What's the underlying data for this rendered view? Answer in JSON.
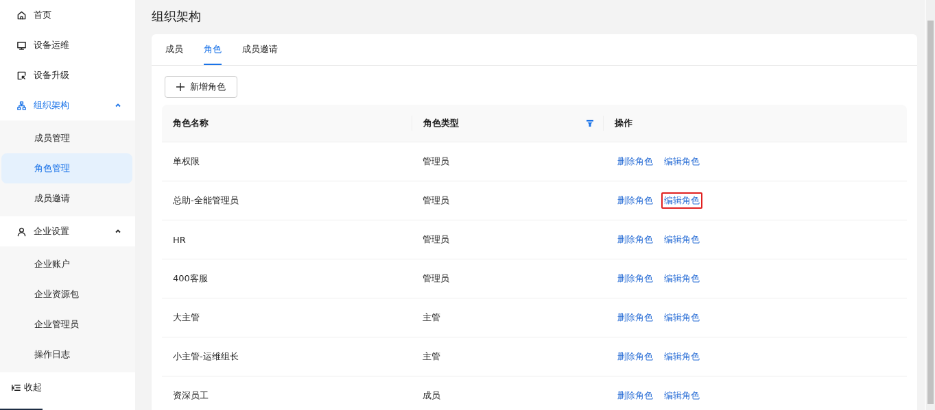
{
  "sidebar": {
    "items": [
      {
        "label": "首页"
      },
      {
        "label": "设备运维"
      },
      {
        "label": "设备升级"
      },
      {
        "label": "组织架构",
        "expanded": true,
        "active": true,
        "children": [
          {
            "label": "成员管理",
            "selected": false
          },
          {
            "label": "角色管理",
            "selected": true
          },
          {
            "label": "成员邀请",
            "selected": false
          }
        ]
      },
      {
        "label": "企业设置",
        "expanded": true,
        "active": false,
        "children": [
          {
            "label": "企业账户",
            "selected": false
          },
          {
            "label": "企业资源包",
            "selected": false
          },
          {
            "label": "企业管理员",
            "selected": false
          },
          {
            "label": "操作日志",
            "selected": false
          }
        ]
      }
    ],
    "collapse": "收起"
  },
  "page": {
    "title": "组织架构"
  },
  "tabs": [
    {
      "label": "成员",
      "selected": false
    },
    {
      "label": "角色",
      "selected": true
    },
    {
      "label": "成员邀请",
      "selected": false
    }
  ],
  "add_button": "新增角色",
  "table": {
    "columns": [
      {
        "label": "角色名称",
        "filter": false
      },
      {
        "label": "角色类型",
        "filter": true
      },
      {
        "label": "操作",
        "filter": false
      }
    ],
    "rows": [
      {
        "name": "单权限",
        "type": "管理员",
        "actions": [
          {
            "label": "删除角色",
            "highlighted": false
          },
          {
            "label": "编辑角色",
            "highlighted": false
          }
        ]
      },
      {
        "name": "总助-全能管理员",
        "type": "管理员",
        "actions": [
          {
            "label": "删除角色",
            "highlighted": false
          },
          {
            "label": "编辑角色",
            "highlighted": true
          }
        ]
      },
      {
        "name": "HR",
        "type": "管理员",
        "actions": [
          {
            "label": "删除角色",
            "highlighted": false
          },
          {
            "label": "编辑角色",
            "highlighted": false
          }
        ]
      },
      {
        "name": "400客服",
        "type": "管理员",
        "actions": [
          {
            "label": "删除角色",
            "highlighted": false
          },
          {
            "label": "编辑角色",
            "highlighted": false
          }
        ]
      },
      {
        "name": "大主管",
        "type": "主管",
        "actions": [
          {
            "label": "删除角色",
            "highlighted": false
          },
          {
            "label": "编辑角色",
            "highlighted": false
          }
        ]
      },
      {
        "name": "小主管-运维组长",
        "type": "主管",
        "actions": [
          {
            "label": "删除角色",
            "highlighted": false
          },
          {
            "label": "编辑角色",
            "highlighted": false
          }
        ]
      },
      {
        "name": "资深员工",
        "type": "成员",
        "actions": [
          {
            "label": "删除角色",
            "highlighted": false
          },
          {
            "label": "编辑角色",
            "highlighted": false
          }
        ]
      }
    ]
  }
}
